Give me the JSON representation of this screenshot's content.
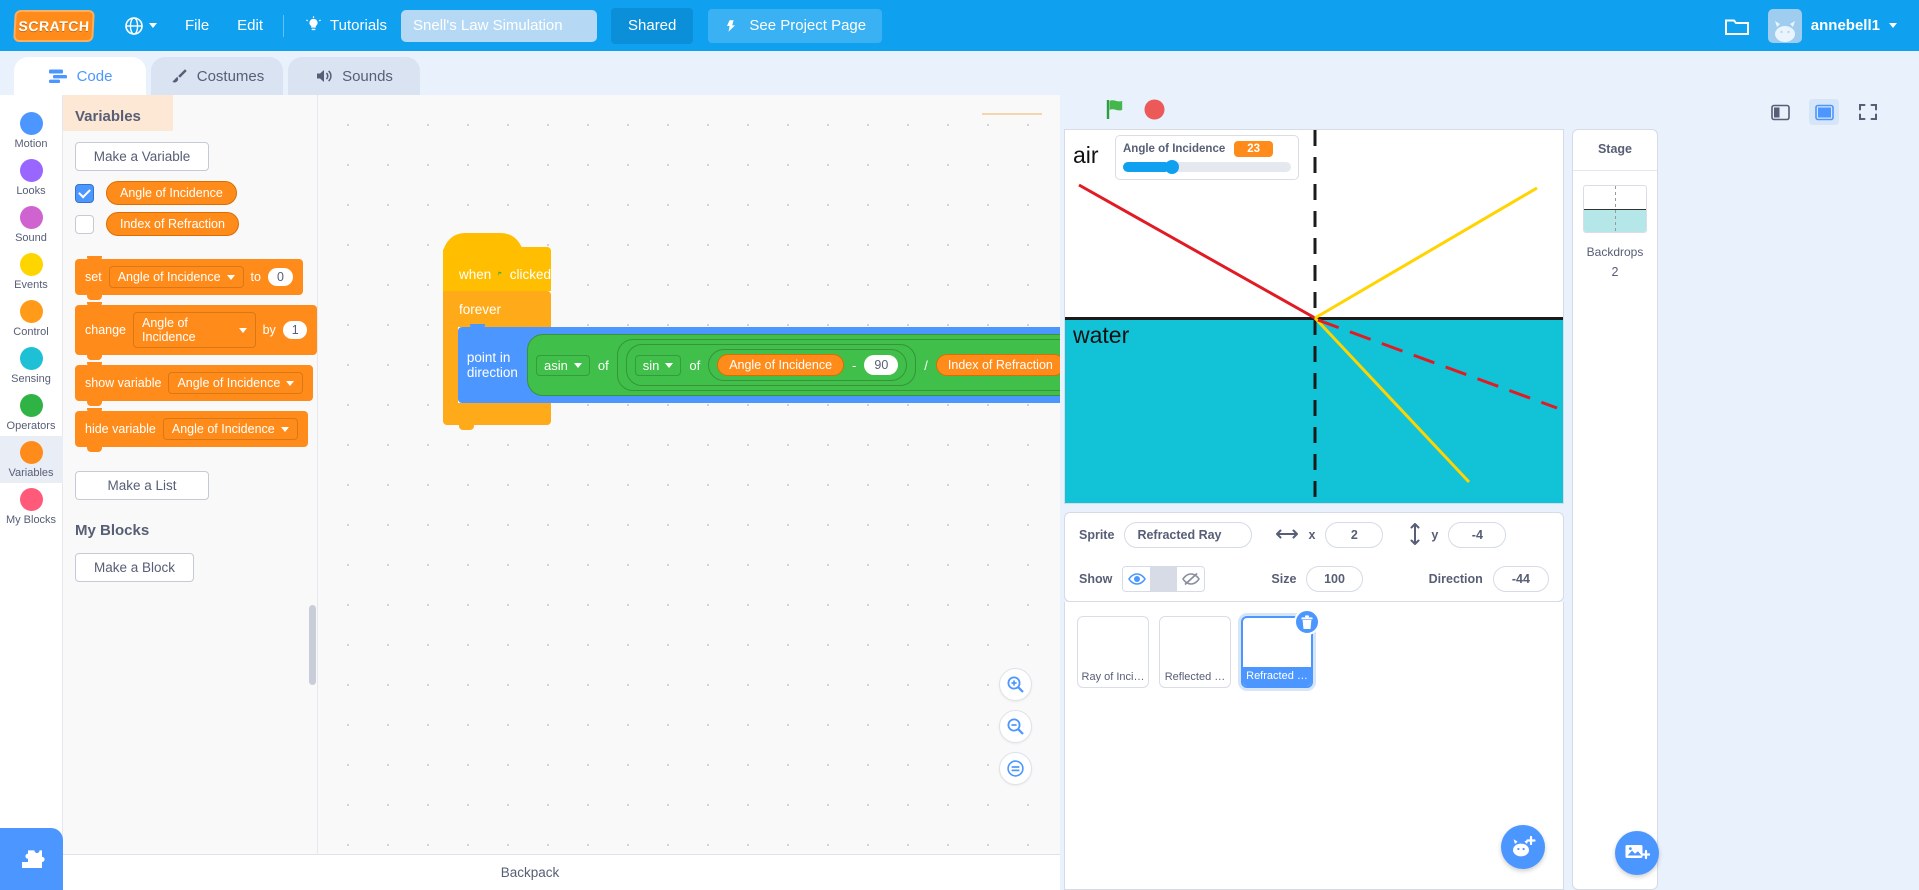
{
  "menubar": {
    "logo": "SCRATCH",
    "language_icon": "globe-icon",
    "file": "File",
    "edit": "Edit",
    "tutorials": "Tutorials",
    "project_title": "Snell's Law Simulation",
    "project_title_placeholder": "Project title",
    "shared": "Shared",
    "see_project_page": "See Project Page",
    "folder_icon": "folder-icon",
    "username": "annebell1"
  },
  "tabs": [
    {
      "label": "Code",
      "icon": "code-icon",
      "active": true
    },
    {
      "label": "Costumes",
      "icon": "paintbrush-icon",
      "active": false
    },
    {
      "label": "Sounds",
      "icon": "speaker-icon",
      "active": false
    }
  ],
  "categories": [
    {
      "label": "Motion",
      "color": "#4c97ff",
      "selected": false
    },
    {
      "label": "Looks",
      "color": "#9966ff",
      "selected": false
    },
    {
      "label": "Sound",
      "color": "#cf63cf",
      "selected": false
    },
    {
      "label": "Events",
      "color": "#ffd500",
      "selected": false
    },
    {
      "label": "Control",
      "color": "#ff9b18",
      "selected": false
    },
    {
      "label": "Sensing",
      "color": "#1ec0d6",
      "selected": false
    },
    {
      "label": "Operators",
      "color": "#2fb344",
      "selected": false
    },
    {
      "label": "Variables",
      "color": "#ff8c1a",
      "selected": true
    },
    {
      "label": "My Blocks",
      "color": "#ff5a79",
      "selected": false
    }
  ],
  "add_extension_icon": "add-extension-icon",
  "palette": {
    "heading": "Variables",
    "make_variable": "Make a Variable",
    "variables": [
      {
        "name": "Angle of Incidence",
        "checked": true
      },
      {
        "name": "Index of Refraction",
        "checked": false
      }
    ],
    "blocks": [
      {
        "kind": "set",
        "prefix": "set",
        "dropdown": "Angle of Incidence",
        "mid": "to",
        "value": "0"
      },
      {
        "kind": "change",
        "prefix": "change",
        "dropdown": "Angle of Incidence",
        "mid": "by",
        "value": "1"
      },
      {
        "kind": "show",
        "prefix": "show variable",
        "dropdown": "Angle of Incidence"
      },
      {
        "kind": "hide",
        "prefix": "hide variable",
        "dropdown": "Angle of Incidence"
      }
    ],
    "make_list": "Make a List",
    "my_blocks_heading": "My Blocks",
    "make_block": "Make a Block"
  },
  "script": {
    "hat_when": "when",
    "hat_flag_icon": "green-flag-icon",
    "hat_clicked": "clicked",
    "forever": "forever",
    "point_in_direction": "point in direction",
    "asin": "asin",
    "of1": "of",
    "sin": "sin",
    "of2": "of",
    "var_angle": "Angle of Incidence",
    "minus": "-",
    "ninety": "90",
    "divide": "/",
    "var_index": "Index of Refraction"
  },
  "workspace_controls": {
    "zoom_in_icon": "zoom-in-icon",
    "zoom_out_icon": "zoom-out-icon",
    "zoom_reset_icon": "zoom-reset-icon"
  },
  "backpack": {
    "label": "Backpack"
  },
  "stage_controls": {
    "green_flag_icon": "green-flag-icon",
    "stop_icon": "stop-sign-icon",
    "small_stage_icon": "small-stage-icon",
    "large_stage_icon": "large-stage-icon",
    "fullscreen_icon": "fullscreen-icon"
  },
  "stage": {
    "air_label": "air",
    "water_label": "water",
    "monitor": {
      "name": "Angle of Incidence",
      "value": "23"
    }
  },
  "sprite_info": {
    "sprite_label": "Sprite",
    "sprite_name": "Refracted Ray",
    "x_label": "x",
    "x_value": "2",
    "y_label": "y",
    "y_value": "-4",
    "show_label": "Show",
    "show_icon": "eye-icon",
    "hide_icon": "eye-slash-icon",
    "size_label": "Size",
    "size_value": "100",
    "direction_label": "Direction",
    "direction_value": "-44",
    "x_arrow_icon": "horizontal-arrow-icon",
    "y_arrow_icon": "vertical-arrow-icon"
  },
  "sprites": [
    {
      "name": "Ray of Inci…",
      "selected": false
    },
    {
      "name": "Reflected …",
      "selected": false
    },
    {
      "name": "Refracted …",
      "selected": true
    }
  ],
  "add_sprite_icon": "add-sprite-icon",
  "stage_panel": {
    "title": "Stage",
    "backdrops_label": "Backdrops",
    "backdrops_count": "2",
    "add_backdrop_icon": "add-backdrop-icon"
  },
  "colors": {
    "brand_blue": "#0fa0f0",
    "motion_blue": "#4c97ff",
    "variable_orange": "#ff8c1a",
    "operator_green": "#40bf4a",
    "control_orange": "#ffab19",
    "event_yellow": "#ffbf00",
    "water_cyan": "#12c2d6",
    "incident_ray": "#e01b24",
    "reflected_ray": "#ffd400",
    "refracted_ray": "#ffd400"
  }
}
